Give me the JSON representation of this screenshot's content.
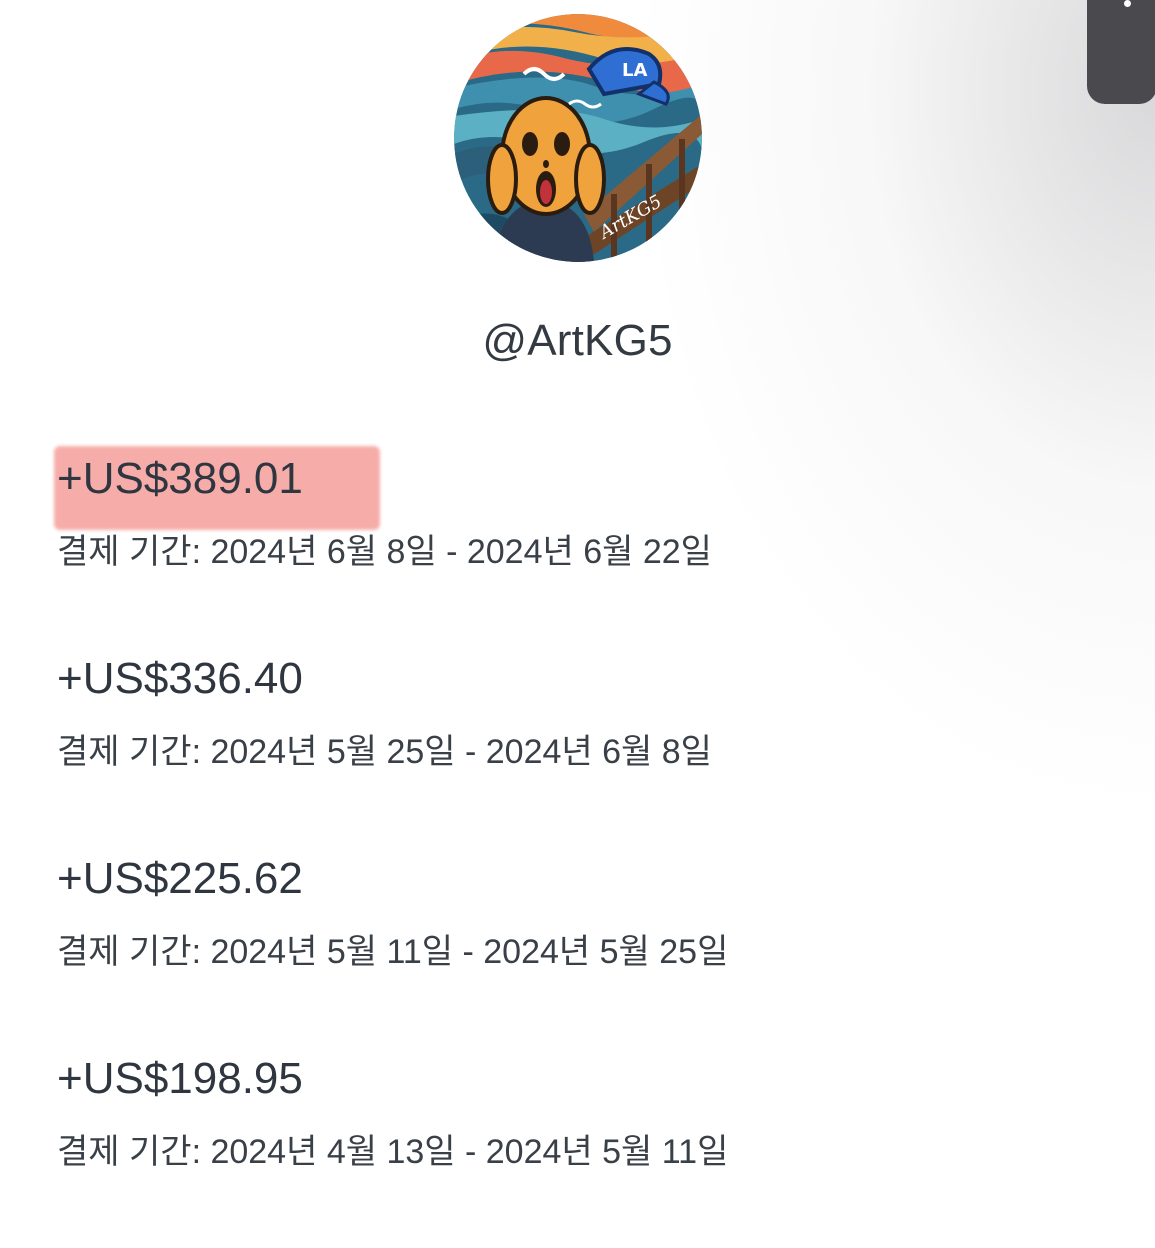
{
  "profile": {
    "handle": "@ArtKG5",
    "avatar_icon": "scream-painting-avatar-icon"
  },
  "accent": {
    "highlight_color": "#f4928d"
  },
  "payouts": [
    {
      "amount": "+US$389.01",
      "period": "결제 기간: 2024년 6월 8일 - 2024년 6월 22일",
      "highlighted": true
    },
    {
      "amount": "+US$336.40",
      "period": "결제 기간: 2024년 5월 25일 - 2024년 6월 8일",
      "highlighted": false
    },
    {
      "amount": "+US$225.62",
      "period": "결제 기간: 2024년 5월 11일 - 2024년 5월 25일",
      "highlighted": false
    },
    {
      "amount": "+US$198.95",
      "period": "결제 기간: 2024년 4월 13일 - 2024년 5월 11일",
      "highlighted": false
    }
  ]
}
